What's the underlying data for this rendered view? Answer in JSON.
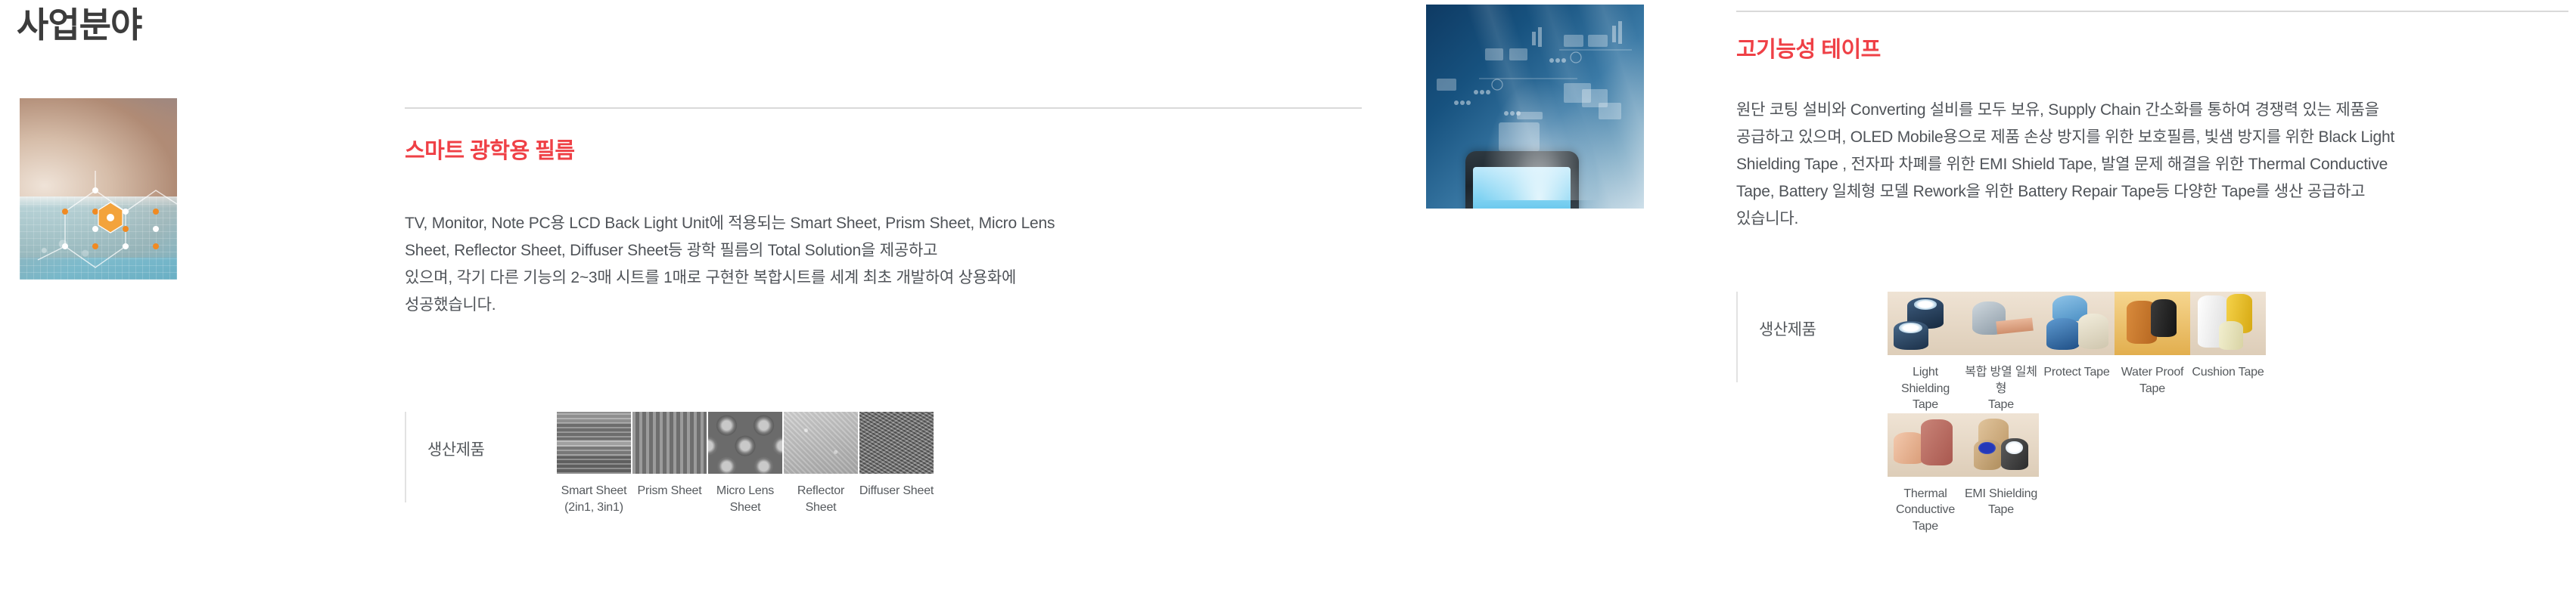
{
  "page": {
    "title": "사업분야"
  },
  "hero_left": {
    "alt_name": "smart-film-hand-hologram-image"
  },
  "hero_mid": {
    "alt_name": "tape-smartphone-network-image"
  },
  "sections": [
    {
      "id": "smart-optical-film",
      "title": "스마트 광학용 필름",
      "body": "TV, Monitor, Note PC용 LCD Back Light Unit에 적용되는 Smart Sheet, Prism Sheet, Micro Lens\nSheet, Reflector Sheet, Diffuser Sheet등 광학 필름의 Total Solution을 제공하고\n있으며, 각기 다른 기능의 2~3매 시트를 1매로 구현한 복합시트를 세계 최초 개발하여 상용화에\n성공했습니다.",
      "products_label": "생산제품",
      "products": [
        {
          "caption": "Smart Sheet\n(2in1, 3in1)",
          "thumb": "smart-sheet-thumb"
        },
        {
          "caption": "Prism Sheet",
          "thumb": "prism-sheet-thumb"
        },
        {
          "caption": "Micro Lens Sheet",
          "thumb": "micro-lens-sheet-thumb"
        },
        {
          "caption": "Reflector Sheet",
          "thumb": "reflector-sheet-thumb"
        },
        {
          "caption": "Diffuser Sheet",
          "thumb": "diffuser-sheet-thumb"
        }
      ]
    },
    {
      "id": "high-performance-tape",
      "title": "고기능성 테이프",
      "body": "원단 코팅 설비와 Converting 설비를 모두 보유, Supply Chain 간소화를 통하여 경쟁력 있는 제품을\n공급하고 있으며, OLED Mobile용으로 제품 손상 방지를 위한 보호필름, 빛샘 방지를 위한 Black Light\nShielding Tape , 전자파 차폐를 위한 EMI Shield Tape, 발열 문제 해결을 위한 Thermal Conductive\nTape, Battery 일체형 모델 Rework을 위한 Battery Repair Tape등 다양한 Tape를 생산 공급하고\n있습니다.",
      "products_label": "생산제품",
      "products": [
        {
          "caption": "Light Shielding\nTape",
          "thumb": "light-shielding-tape-thumb"
        },
        {
          "caption": "복합 방열 일체형\nTape",
          "thumb": "hybrid-heat-dissipation-tape-thumb"
        },
        {
          "caption": "Protect Tape",
          "thumb": "protect-tape-thumb"
        },
        {
          "caption": "Water Proof Tape",
          "thumb": "water-proof-tape-thumb"
        },
        {
          "caption": "Cushion Tape",
          "thumb": "cushion-tape-thumb"
        },
        {
          "caption": "Thermal\nConductive Tape",
          "thumb": "thermal-conductive-tape-thumb"
        },
        {
          "caption": "EMI Shielding\nTape",
          "thumb": "emi-shielding-tape-thumb"
        }
      ]
    }
  ],
  "colors": {
    "heading_red": "#ef4046",
    "body_gray": "#4f5358",
    "title_dark": "#3c3c3c",
    "rule_gray": "#d9d9d9"
  }
}
